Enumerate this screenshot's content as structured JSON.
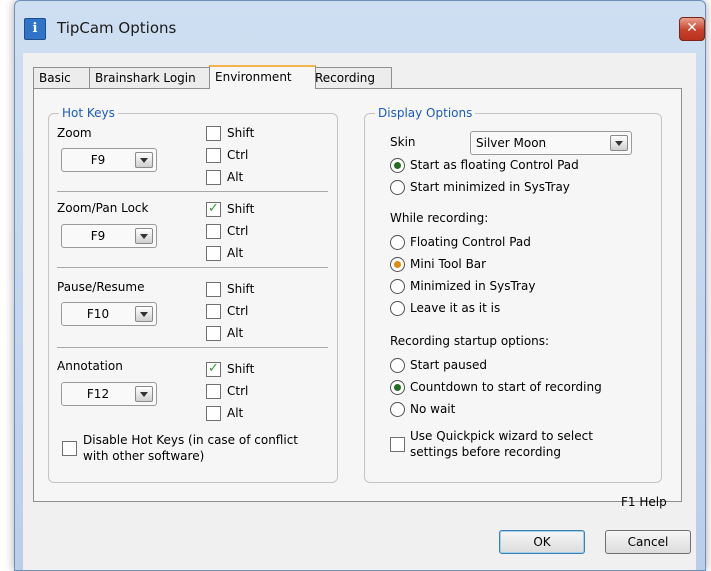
{
  "window": {
    "title": "TipCam Options",
    "icon": "app-icon",
    "close_glyph": "✕"
  },
  "tabs": [
    {
      "label": "Basic",
      "active": false
    },
    {
      "label": "Brainshark Login",
      "active": false
    },
    {
      "label": "Environment",
      "active": true
    },
    {
      "label": "Recording",
      "active": false
    }
  ],
  "hot_keys": {
    "title": "Hot Keys",
    "modifier_labels": {
      "shift": "Shift",
      "ctrl": "Ctrl",
      "alt": "Alt"
    },
    "entries": [
      {
        "label": "Zoom",
        "key": "F9",
        "shift": false,
        "ctrl": false,
        "alt": false
      },
      {
        "label": "Zoom/Pan Lock",
        "key": "F9",
        "shift": true,
        "ctrl": false,
        "alt": false
      },
      {
        "label": "Pause/Resume",
        "key": "F10",
        "shift": false,
        "ctrl": false,
        "alt": false
      },
      {
        "label": "Annotation",
        "key": "F12",
        "shift": true,
        "ctrl": false,
        "alt": false
      }
    ],
    "disable_label_line1": "Disable Hot Keys (in case of conflict",
    "disable_label_line2": "with other software)",
    "disable_checked": false
  },
  "display_options": {
    "title": "Display Options",
    "skin_label": "Skin",
    "skin_value": "Silver Moon",
    "start_options": [
      {
        "label": "Start as floating Control Pad",
        "selected": true
      },
      {
        "label": "Start minimized in SysTray",
        "selected": false
      }
    ],
    "while_recording_label": "While recording:",
    "while_recording_options": [
      {
        "label": "Floating Control Pad",
        "selected": false
      },
      {
        "label": "Mini Tool Bar",
        "selected": true
      },
      {
        "label": "Minimized in SysTray",
        "selected": false
      },
      {
        "label": "Leave it as it is",
        "selected": false
      }
    ],
    "startup_label": "Recording startup options:",
    "startup_options": [
      {
        "label": "Start paused",
        "selected": false
      },
      {
        "label": "Countdown to start of recording",
        "selected": true
      },
      {
        "label": "No wait",
        "selected": false
      }
    ],
    "quickpick_line1": "Use Quickpick wizard to select",
    "quickpick_line2": "settings before recording",
    "quickpick_checked": false
  },
  "help_label": "F1 Help",
  "buttons": {
    "ok": "OK",
    "cancel": "Cancel"
  }
}
